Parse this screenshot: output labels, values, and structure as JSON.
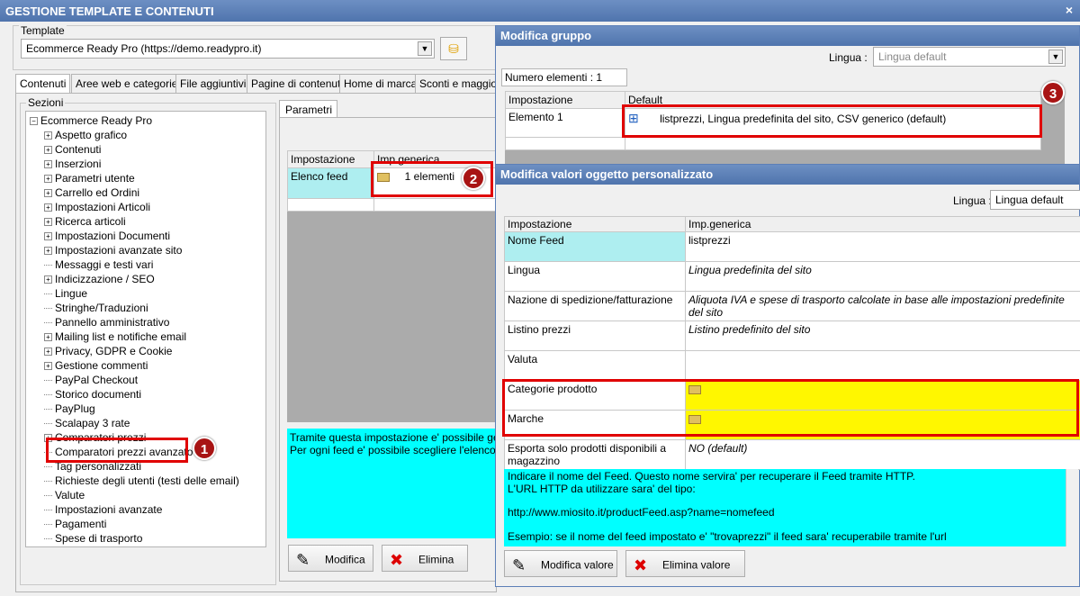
{
  "main": {
    "title": "GESTIONE TEMPLATE E CONTENUTI",
    "close": "×",
    "template_label": "Template",
    "template_value": "Ecommerce Ready Pro (https://demo.readypro.it)",
    "tabs": [
      "Contenuti",
      "Aree web e categorie",
      "File aggiuntivi",
      "Pagine di contenuti",
      "Home di marca",
      "Sconti e maggiora"
    ],
    "sections_label": "Sezioni",
    "tree": {
      "root": "Ecommerce Ready Pro",
      "items": [
        {
          "label": "Aspetto grafico",
          "expand": true
        },
        {
          "label": "Contenuti",
          "expand": true
        },
        {
          "label": "Inserzioni",
          "expand": true
        },
        {
          "label": "Parametri utente",
          "expand": true
        },
        {
          "label": "Carrello ed Ordini",
          "expand": true
        },
        {
          "label": "Impostazioni Articoli",
          "expand": true
        },
        {
          "label": "Ricerca articoli",
          "expand": true
        },
        {
          "label": "Impostazioni Documenti",
          "expand": true
        },
        {
          "label": "Impostazioni avanzate sito",
          "expand": true
        },
        {
          "label": "Messaggi e testi vari",
          "expand": false
        },
        {
          "label": "Indicizzazione / SEO",
          "expand": true
        },
        {
          "label": "Lingue",
          "expand": false
        },
        {
          "label": "Stringhe/Traduzioni",
          "expand": false
        },
        {
          "label": "Pannello amministrativo",
          "expand": false
        },
        {
          "label": "Mailing list e notifiche email",
          "expand": true
        },
        {
          "label": "Privacy, GDPR e Cookie",
          "expand": true
        },
        {
          "label": "Gestione commenti",
          "expand": true
        },
        {
          "label": "PayPal Checkout",
          "expand": false
        },
        {
          "label": "Storico documenti",
          "expand": false
        },
        {
          "label": "PayPlug",
          "expand": false
        },
        {
          "label": "Scalapay 3 rate",
          "expand": false
        },
        {
          "label": "Comparatori prezzi",
          "expand": true
        },
        {
          "label": "Comparatori prezzi avanzato",
          "expand": false
        },
        {
          "label": "Tag personalizzati",
          "expand": false
        },
        {
          "label": "Richieste degli utenti (testi delle email)",
          "expand": false
        },
        {
          "label": "Valute",
          "expand": false
        },
        {
          "label": "Impostazioni avanzate",
          "expand": false
        },
        {
          "label": "Pagamenti",
          "expand": false
        },
        {
          "label": "Spese di trasporto",
          "expand": false
        }
      ]
    },
    "params_tab": "Parametri",
    "grid_headers": [
      "Impostazione",
      "Imp.generica"
    ],
    "grid_row": {
      "setting": "Elenco feed",
      "value": "1 elementi"
    },
    "description": "Tramite questa impostazione e' possibile gestire\nPer ogni feed e' possibile scegliere l'elenco dett",
    "modify_button": "Modifica",
    "delete_button": "Elimina"
  },
  "group_window": {
    "title": "Modifica gruppo",
    "lingua_label": "Lingua :",
    "lingua_value": "Lingua default",
    "count": "Numero elementi : 1",
    "headers": [
      "Impostazione",
      "Default"
    ],
    "row": {
      "setting": "Elemento 1",
      "value": "listprezzi, Lingua predefinita del sito, CSV generico (default)"
    }
  },
  "custom_window": {
    "title": "Modifica valori oggetto personalizzato",
    "lingua_label": "Lingua :",
    "lingua_value": "Lingua default",
    "headers": [
      "Impostazione",
      "Imp.generica"
    ],
    "rows": [
      {
        "setting": "Nome Feed",
        "value": "listprezzi"
      },
      {
        "setting": "Lingua",
        "value": "Lingua predefinita del sito"
      },
      {
        "setting": "Nazione di spedizione/fatturazione",
        "value": "Aliquota IVA e spese di trasporto calcolate in base alle impostazioni predefinite del sito"
      },
      {
        "setting": "Listino prezzi",
        "value": "Listino predefinito del sito"
      },
      {
        "setting": "Valuta",
        "value": ""
      },
      {
        "setting": "Categorie prodotto",
        "value": ""
      },
      {
        "setting": "Marche",
        "value": ""
      },
      {
        "setting": "Esporta solo prodotti disponibili a magazzino",
        "value": "NO (default)"
      }
    ],
    "description_lines": [
      "Indicare il nome del Feed. Questo nome servira' per recuperare il Feed tramite HTTP.",
      "L'URL HTTP da utilizzare sara' del tipo:",
      "",
      "http://www.miosito.it/productFeed.asp?name=nomefeed",
      "",
      "Esempio: se il nome del feed impostato e' \"trovaprezzi\" il feed sara' recuperabile tramite l'url"
    ],
    "modify_button": "Modifica valore",
    "delete_button": "Elimina valore"
  },
  "badges": [
    "1",
    "2",
    "3"
  ],
  "colors": {
    "highlight": "#aeeef0",
    "yellow": "#fff700",
    "red": "#e00000",
    "title": "#4f74ad"
  }
}
